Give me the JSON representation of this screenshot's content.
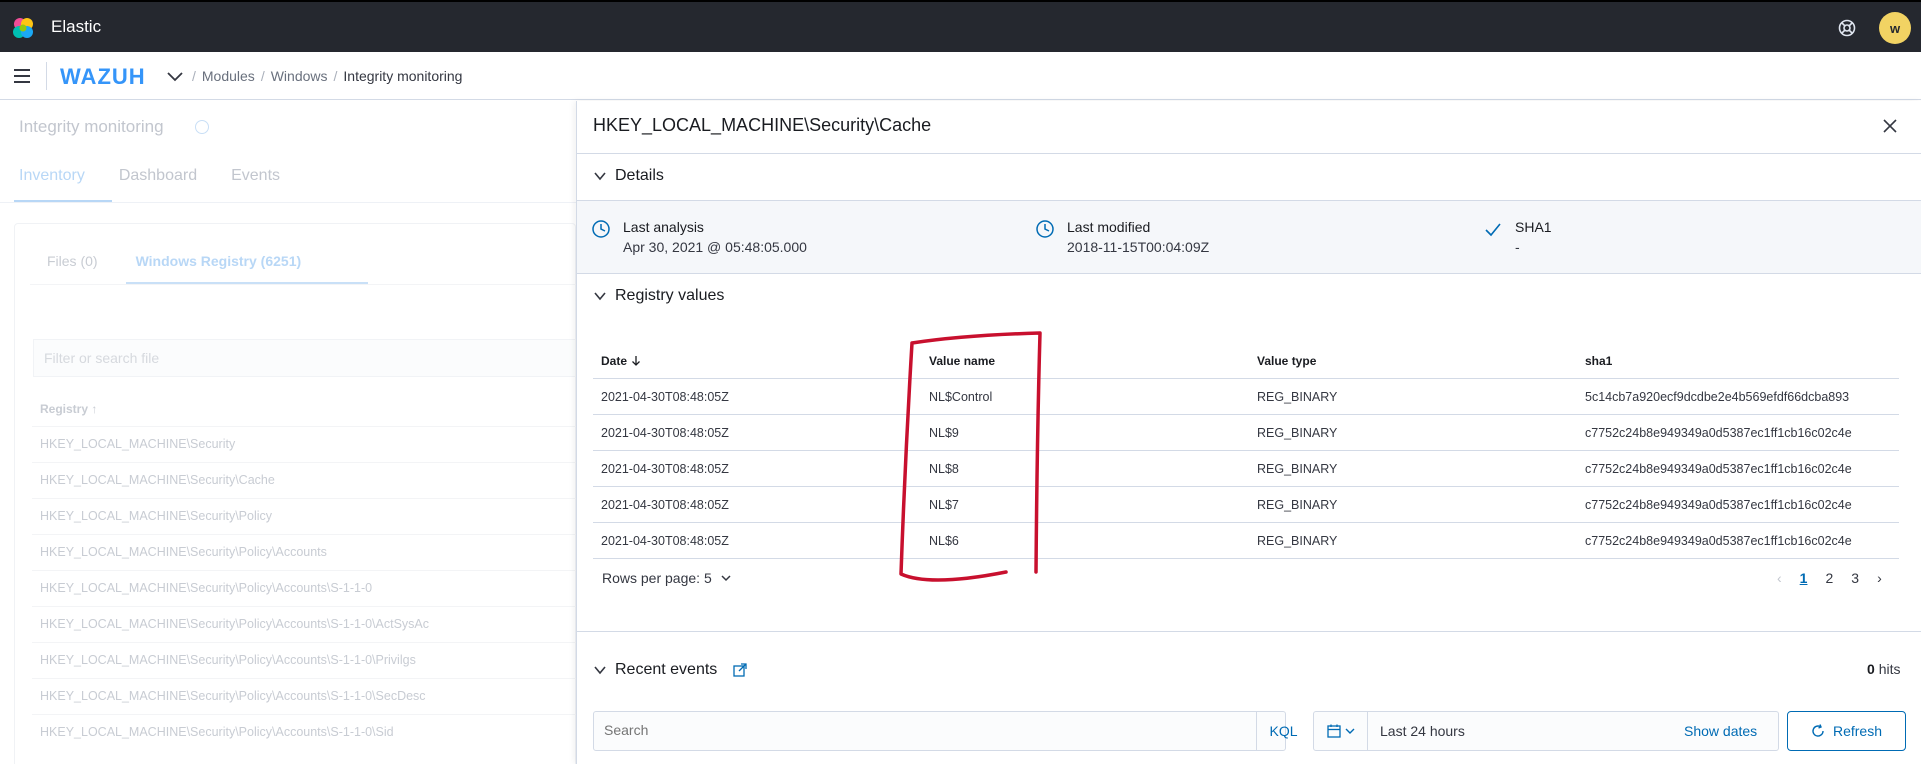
{
  "header": {
    "app_title": "Elastic",
    "avatar_initial": "w"
  },
  "navbar": {
    "logo_text": "WAZUH",
    "breadcrumbs": [
      "Modules",
      "Windows",
      "Integrity monitoring"
    ]
  },
  "background": {
    "title": "Integrity monitoring",
    "tabs": [
      "Inventory",
      "Dashboard",
      "Events"
    ],
    "subtabs": [
      "Files (0)",
      "Windows Registry (6251)"
    ],
    "filter_placeholder": "Filter or search file",
    "column_header": "Registry",
    "rows": [
      "HKEY_LOCAL_MACHINE\\Security",
      "HKEY_LOCAL_MACHINE\\Security\\Cache",
      "HKEY_LOCAL_MACHINE\\Security\\Policy",
      "HKEY_LOCAL_MACHINE\\Security\\Policy\\Accounts",
      "HKEY_LOCAL_MACHINE\\Security\\Policy\\Accounts\\S-1-1-0",
      "HKEY_LOCAL_MACHINE\\Security\\Policy\\Accounts\\S-1-1-0\\ActSysAc",
      "HKEY_LOCAL_MACHINE\\Security\\Policy\\Accounts\\S-1-1-0\\Privilgs",
      "HKEY_LOCAL_MACHINE\\Security\\Policy\\Accounts\\S-1-1-0\\SecDesc",
      "HKEY_LOCAL_MACHINE\\Security\\Policy\\Accounts\\S-1-1-0\\Sid"
    ]
  },
  "flyout": {
    "title": "HKEY_LOCAL_MACHINE\\Security\\Cache",
    "details_label": "Details",
    "details": [
      {
        "label": "Last analysis",
        "value": "Apr 30, 2021 @ 05:48:05.000",
        "icon": "clock-icon"
      },
      {
        "label": "Last modified",
        "value": "2018-11-15T00:04:09Z",
        "icon": "clock-icon"
      },
      {
        "label": "SHA1",
        "value": "-",
        "icon": "check-icon"
      }
    ],
    "registry_label": "Registry values",
    "table": {
      "columns": [
        "Date",
        "Value name",
        "Value type",
        "sha1"
      ],
      "rows": [
        [
          "2021-04-30T08:48:05Z",
          "NL$Control",
          "REG_BINARY",
          "5c14cb7a920ecf9dcdbe2e4b569efdf66dcba893"
        ],
        [
          "2021-04-30T08:48:05Z",
          "NL$9",
          "REG_BINARY",
          "c7752c24b8e949349a0d5387ec1ff1cb16c02c4e"
        ],
        [
          "2021-04-30T08:48:05Z",
          "NL$8",
          "REG_BINARY",
          "c7752c24b8e949349a0d5387ec1ff1cb16c02c4e"
        ],
        [
          "2021-04-30T08:48:05Z",
          "NL$7",
          "REG_BINARY",
          "c7752c24b8e949349a0d5387ec1ff1cb16c02c4e"
        ],
        [
          "2021-04-30T08:48:05Z",
          "NL$6",
          "REG_BINARY",
          "c7752c24b8e949349a0d5387ec1ff1cb16c02c4e"
        ]
      ]
    },
    "rows_per_page": "Rows per page: 5",
    "pages": [
      "1",
      "2",
      "3"
    ],
    "recent_events_label": "Recent events",
    "hits_count": "0",
    "hits_label": "hits",
    "search_placeholder": "Search",
    "kql_label": "KQL",
    "date_value": "Last 24 hours",
    "show_dates_label": "Show dates",
    "refresh_label": "Refresh"
  },
  "colors": {
    "accent": "#006bb4",
    "header_bg": "#25282f",
    "avatar": "#f2d363",
    "annotation": "#c8102e"
  }
}
